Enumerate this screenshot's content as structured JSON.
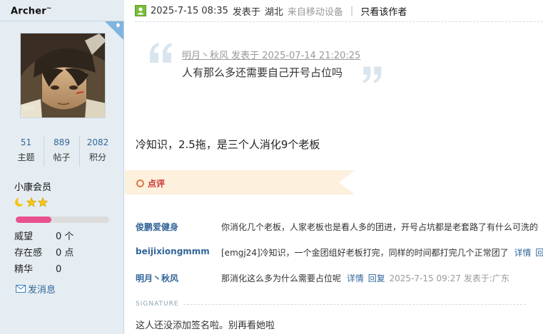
{
  "user": {
    "name": "Archer",
    "name_mark": "~",
    "stats": [
      {
        "value": "51",
        "label": "主题"
      },
      {
        "value": "889",
        "label": "帖子"
      },
      {
        "value": "2082",
        "label": "积分"
      }
    ],
    "level": "小康会员",
    "stars": [
      "moon-icon",
      "star-icon",
      "star-icon"
    ],
    "progress_fraction": 0.38,
    "info": [
      {
        "key": "威望",
        "value": "0 个"
      },
      {
        "key": "存在感",
        "value": "0 点"
      },
      {
        "key": "精华",
        "value": "0"
      }
    ],
    "send_message": "发消息"
  },
  "post": {
    "meta": {
      "datetime": "2025-7-15 08:35",
      "posted_at": "发表于",
      "location": "湖北",
      "device": "来自移动设备",
      "separator": "|",
      "only_author": "只看该作者"
    },
    "quote": {
      "author_line": "明月丶秋风 发表于 2025-07-14 21:20:25",
      "text": "人有那么多还需要自己开号占位吗"
    },
    "body": "冷知识，2.5拖，是三个人消化9个老板"
  },
  "rating": {
    "label": "点评"
  },
  "comments": [
    {
      "author": "俊鹏爱健身",
      "text": "你消化几个老板，人家老板也是看人多的团进，开号占坑都是老套路了有什么可洗的",
      "actions": [],
      "time": ""
    },
    {
      "author": "beijixiongmmm",
      "text": "[emgj24]冷知识，一个金团组好老板打完，同样的时间都打完几个正常团了",
      "actions": [
        "详情",
        "回复"
      ],
      "time": ""
    },
    {
      "author": "明月丶秋风",
      "text": "那消化这么多为什么需要占位呢",
      "actions": [
        "详情",
        "回复"
      ],
      "time": "2025-7-15 09:27 发表于:广东"
    }
  ],
  "signature": {
    "label": "SIGNATURE",
    "text": "这人还没添加签名啦。别再看她啦"
  },
  "colors": {
    "sidebar_bg": "#e5edf2",
    "link": "#336699",
    "ribbon": "#fdf0dc",
    "progress": "#e8508f"
  }
}
